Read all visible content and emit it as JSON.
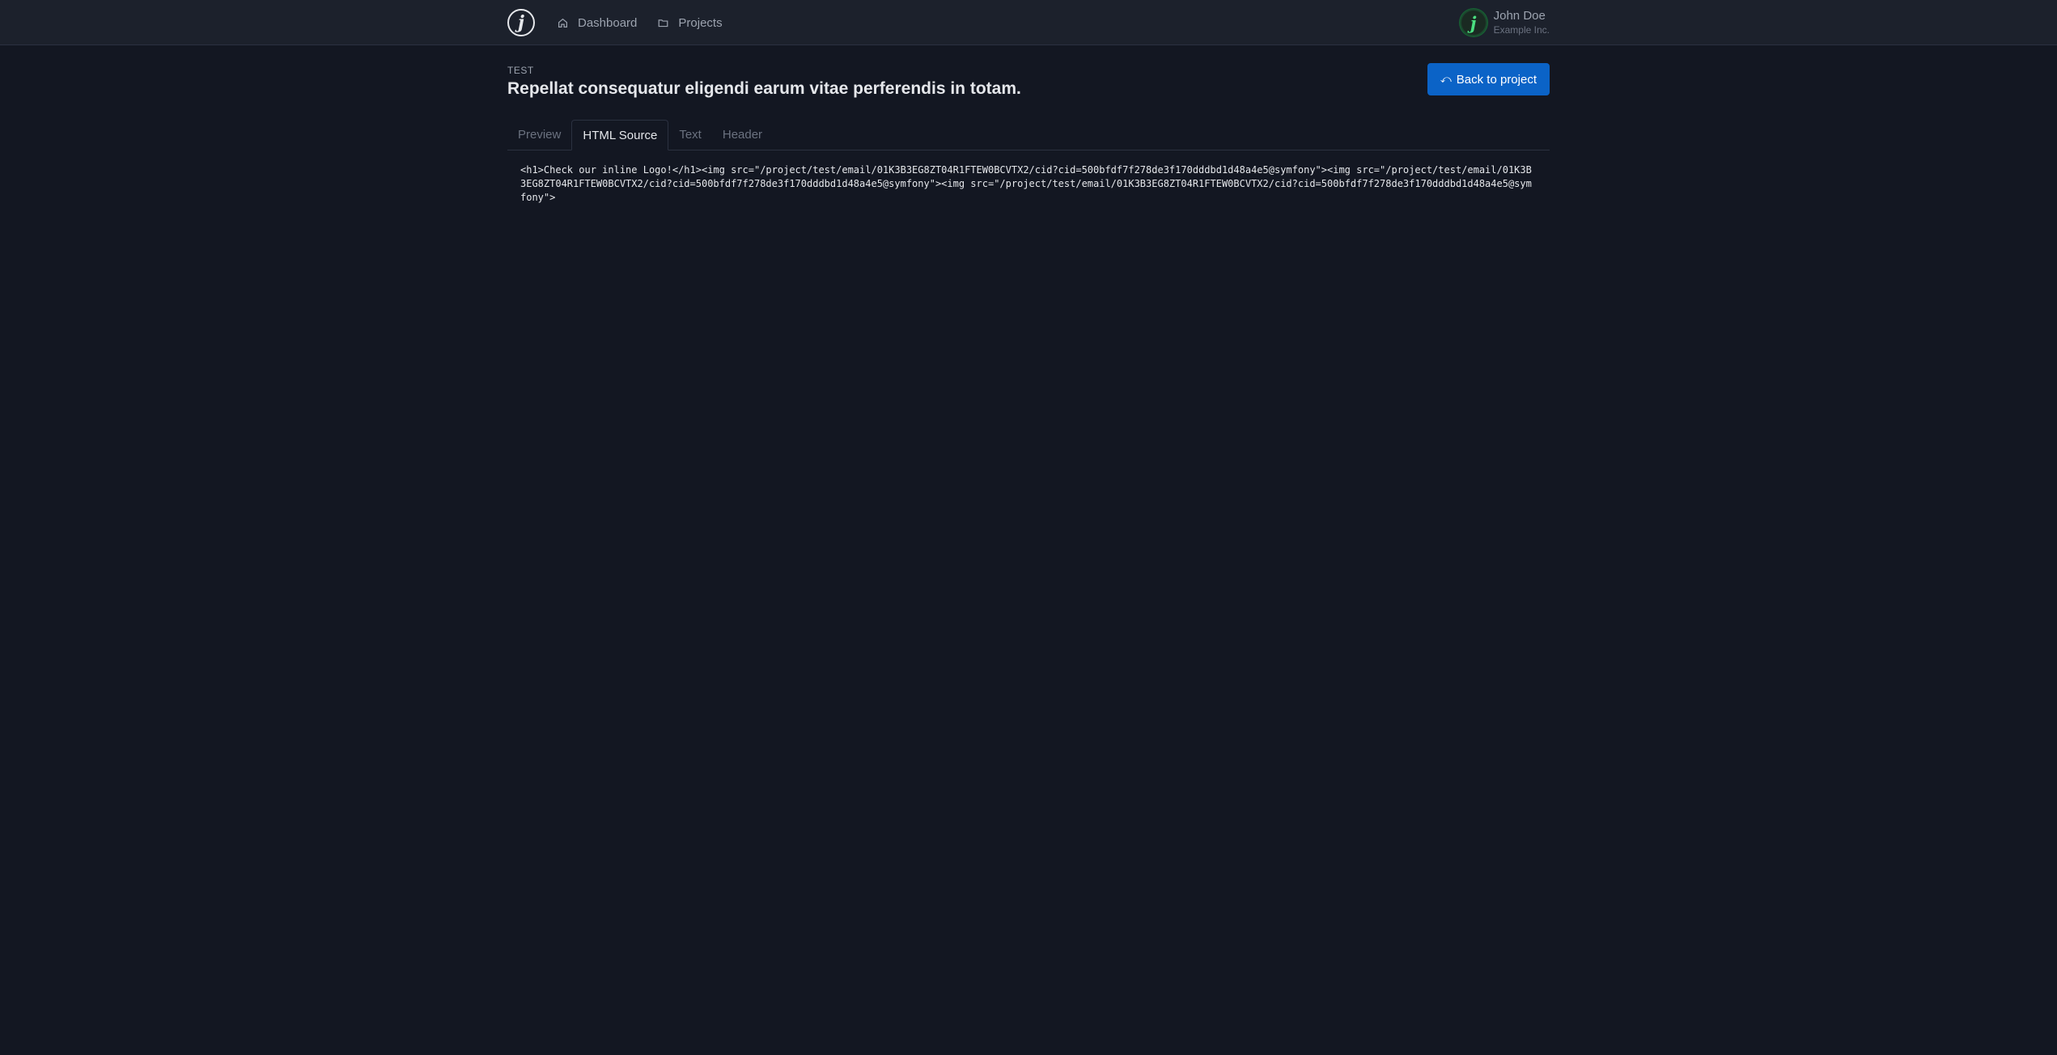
{
  "brand": {
    "logo_glyph": "j"
  },
  "nav": {
    "items": [
      {
        "label": "Dashboard",
        "icon": "home-icon"
      },
      {
        "label": "Projects",
        "icon": "folder-icon"
      }
    ]
  },
  "user": {
    "avatar_glyph": "j",
    "name": "John Doe",
    "company": "Example Inc."
  },
  "page": {
    "eyebrow": "TEST",
    "title": "Repellat consequatur eligendi earum vitae perferendis in totam.",
    "back_label": "Back to project",
    "back_icon": "⤺"
  },
  "tabs": [
    {
      "label": "Preview",
      "active": false
    },
    {
      "label": "HTML Source",
      "active": true
    },
    {
      "label": "Text",
      "active": false
    },
    {
      "label": "Header",
      "active": false
    }
  ],
  "source": {
    "html": "<h1>Check our inline Logo!</h1><img src=\"/project/test/email/01K3B3EG8ZT04R1FTEW0BCVTX2/cid?cid=500bfdf7f278de3f170dddbd1d48a4e5@symfony\"><img src=\"/project/test/email/01K3B3EG8ZT04R1FTEW0BCVTX2/cid?cid=500bfdf7f278de3f170dddbd1d48a4e5@symfony\"><img src=\"/project/test/email/01K3B3EG8ZT04R1FTEW0BCVTX2/cid?cid=500bfdf7f278de3f170dddbd1d48a4e5@symfony\">"
  },
  "colors": {
    "background": "#131722",
    "topbar": "#1c212c",
    "accent": "#0b63c7"
  }
}
